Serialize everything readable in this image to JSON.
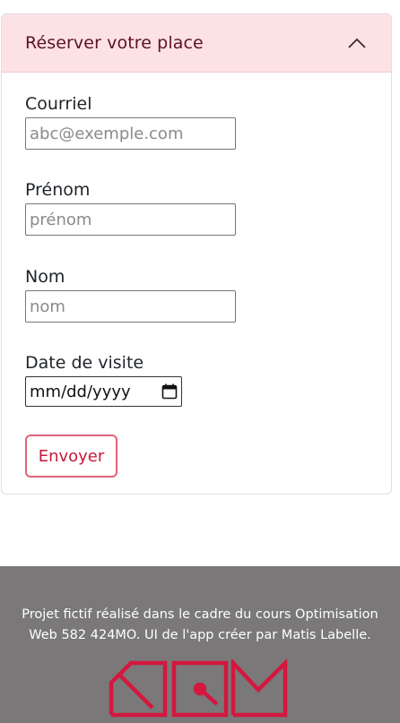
{
  "accordion": {
    "title": "Réserver votre place",
    "expanded": true,
    "toggle_icon": "chevron-up-icon"
  },
  "form": {
    "email": {
      "label": "Courriel",
      "placeholder": "abc@exemple.com",
      "value": ""
    },
    "first_name": {
      "label": "Prénom",
      "placeholder": "prénom",
      "value": ""
    },
    "last_name": {
      "label": "Nom",
      "placeholder": "nom",
      "value": ""
    },
    "visit_date": {
      "label": "Date de visite",
      "value": "mm/dd/yyyy",
      "icon": "calendar-icon"
    },
    "submit_label": "Envoyer"
  },
  "footer": {
    "text": "Projet fictif réalisé dans le cadre du cours Optimisation Web 582 424MO. UI de l'app créer par Matis Labelle.",
    "logo": "AQM-logo"
  },
  "colors": {
    "header_bg": "#fde2e5",
    "accent": "#c8173a",
    "footer_bg": "#7a7878",
    "logo_red": "#d4173f"
  }
}
